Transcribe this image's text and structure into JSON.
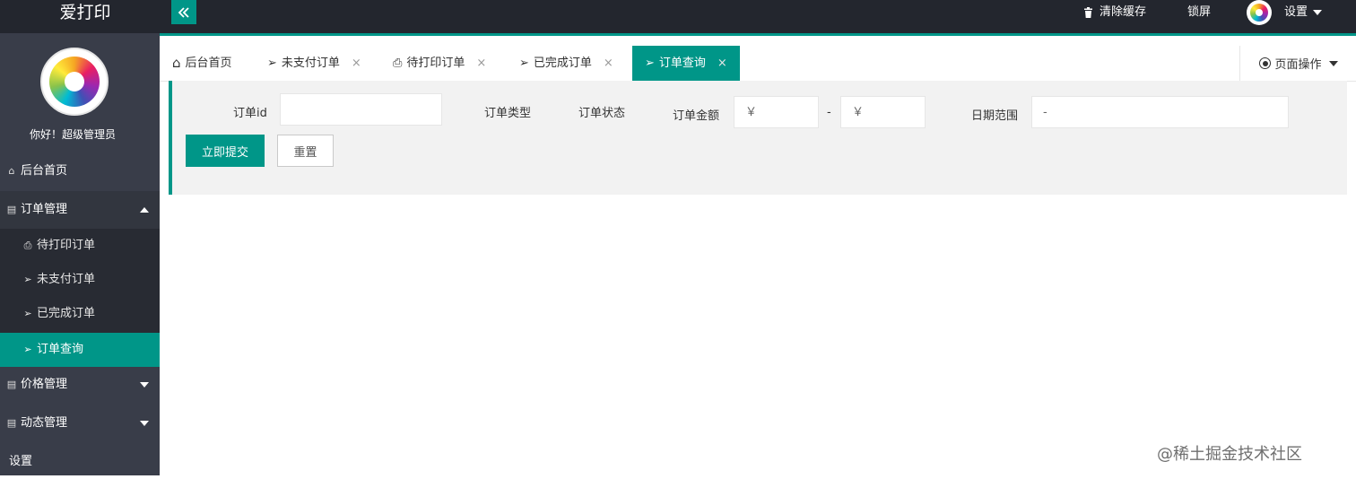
{
  "app": {
    "title": "爱打印"
  },
  "header": {
    "clear_cache": "清除缓存",
    "lock": "锁屏",
    "settings": "设置",
    "colors": {
      "bg": "#23262e",
      "accent": "#009688"
    }
  },
  "sidebar": {
    "greeting": "你好！超级管理员",
    "items": {
      "home": "后台首页",
      "orders": "订单管理",
      "price": "价格管理",
      "news": "动态管理",
      "settings": "设置"
    },
    "sub_items": {
      "to_print": "待打印订单",
      "unpaid": "未支付订单",
      "completed": "已完成订单",
      "query": "订单查询"
    }
  },
  "tabs": {
    "home": "后台首页",
    "unpaid": "未支付订单",
    "to_print": "待打印订单",
    "completed": "已完成订单",
    "query": "订单查询",
    "close": "×",
    "page_ops": "页面操作"
  },
  "form": {
    "order_id_label": "订单id",
    "order_id_value": "",
    "order_type_label": "订单类型",
    "order_status_label": "订单状态",
    "amount_label": "订单金额",
    "amount_min_placeholder": "￥",
    "amount_max_placeholder": "￥",
    "amount_separator": "-",
    "date_label": "日期范围",
    "date_placeholder": "-",
    "submit": "立即提交",
    "reset": "重置"
  },
  "watermark": "@稀土掘金技术社区"
}
